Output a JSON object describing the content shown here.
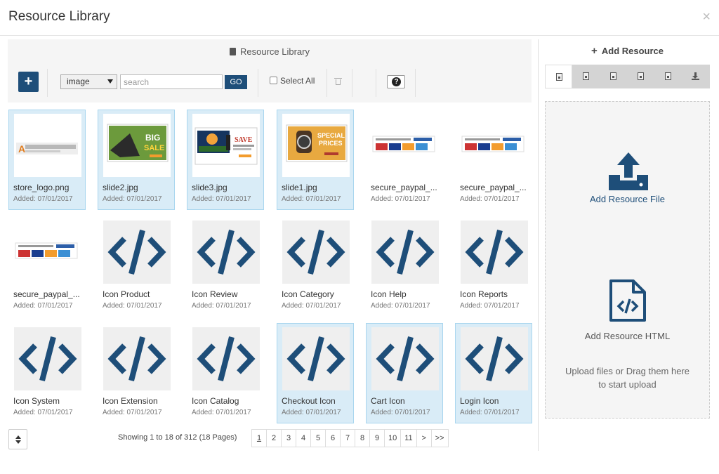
{
  "modal": {
    "title": "Resource Library",
    "close_label": "×"
  },
  "library": {
    "title": "Resource Library",
    "add_label": "+",
    "type_select": {
      "selected": "image"
    },
    "search": {
      "placeholder": "search",
      "value": ""
    },
    "go_label": "GO",
    "select_all_label": "Select All",
    "help_label": "?"
  },
  "tiles": [
    {
      "name": "store_logo.png",
      "date": "Added: 07/01/2017",
      "kind": "logo",
      "selected": true
    },
    {
      "name": "slide2.jpg",
      "date": "Added: 07/01/2017",
      "kind": "slide2",
      "selected": true,
      "banner_text": "BIG",
      "banner_sub": "SALE"
    },
    {
      "name": "slide3.jpg",
      "date": "Added: 07/01/2017",
      "kind": "slide3",
      "selected": true,
      "banner_text": "SAVE"
    },
    {
      "name": "slide1.jpg",
      "date": "Added: 07/01/2017",
      "kind": "slide1",
      "selected": true,
      "banner_text": "SPECIAL",
      "banner_sub": "PRICES"
    },
    {
      "name": "secure_paypal_...",
      "date": "Added: 07/01/2017",
      "kind": "paypal",
      "selected": false
    },
    {
      "name": "secure_paypal_...",
      "date": "Added: 07/01/2017",
      "kind": "paypal",
      "selected": false
    },
    {
      "name": "secure_paypal_...",
      "date": "Added: 07/01/2017",
      "kind": "paypal",
      "selected": false
    },
    {
      "name": "Icon Product",
      "date": "Added: 07/01/2017",
      "kind": "code",
      "selected": false
    },
    {
      "name": "Icon Review",
      "date": "Added: 07/01/2017",
      "kind": "code",
      "selected": false
    },
    {
      "name": "Icon Category",
      "date": "Added: 07/01/2017",
      "kind": "code",
      "selected": false
    },
    {
      "name": "Icon Help",
      "date": "Added: 07/01/2017",
      "kind": "code",
      "selected": false
    },
    {
      "name": "Icon Reports",
      "date": "Added: 07/01/2017",
      "kind": "code",
      "selected": false
    },
    {
      "name": "Icon System",
      "date": "Added: 07/01/2017",
      "kind": "code",
      "selected": false
    },
    {
      "name": "Icon Extension",
      "date": "Added: 07/01/2017",
      "kind": "code",
      "selected": false
    },
    {
      "name": "Icon Catalog",
      "date": "Added: 07/01/2017",
      "kind": "code",
      "selected": false
    },
    {
      "name": "Checkout Icon",
      "date": "Added: 07/01/2017",
      "kind": "code",
      "selected": true
    },
    {
      "name": "Cart Icon",
      "date": "Added: 07/01/2017",
      "kind": "code",
      "selected": true
    },
    {
      "name": "Login Icon",
      "date": "Added: 07/01/2017",
      "kind": "code",
      "selected": true
    }
  ],
  "pagination": {
    "showing": "Showing 1 to 18 of 312 (18 Pages)",
    "pages": [
      "1",
      "2",
      "3",
      "4",
      "5",
      "6",
      "7",
      "8",
      "9",
      "10",
      "11",
      ">",
      ">>"
    ],
    "current": "1"
  },
  "add_resource": {
    "title": "Add Resource",
    "tabs": [
      "image-tab-icon",
      "audio-tab-icon",
      "video-tab-icon",
      "pdf-tab-icon",
      "archive-tab-icon",
      "download-tab-icon"
    ],
    "active_tab": 0,
    "file_label": "Add Resource File",
    "html_label": "Add Resource HTML",
    "hint_line1": "Upload files or Drag them here",
    "hint_line2": "to start upload"
  },
  "colors": {
    "accent": "#1e4e79",
    "selected_bg": "#d9ecf7",
    "selected_border": "#a9d6ef"
  }
}
